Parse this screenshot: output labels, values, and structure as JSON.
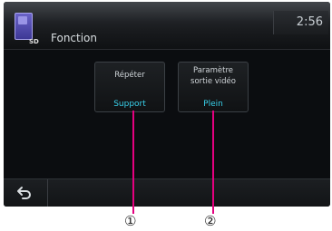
{
  "header": {
    "title": "Fonction",
    "clock": "2:56",
    "source_icon": "sd-card-icon",
    "source_label": "SD"
  },
  "settings": [
    {
      "label_lines": [
        "Répéter"
      ],
      "value": "Support"
    },
    {
      "label_lines": [
        "Paramètre",
        "sortie vidéo"
      ],
      "value": "Plein"
    }
  ],
  "bottom_bar": {
    "back_icon": "back-arrow-icon"
  },
  "callouts": [
    "①",
    "②"
  ],
  "colors": {
    "value_text": "#38d0ea",
    "callout_line": "#e4007f"
  }
}
